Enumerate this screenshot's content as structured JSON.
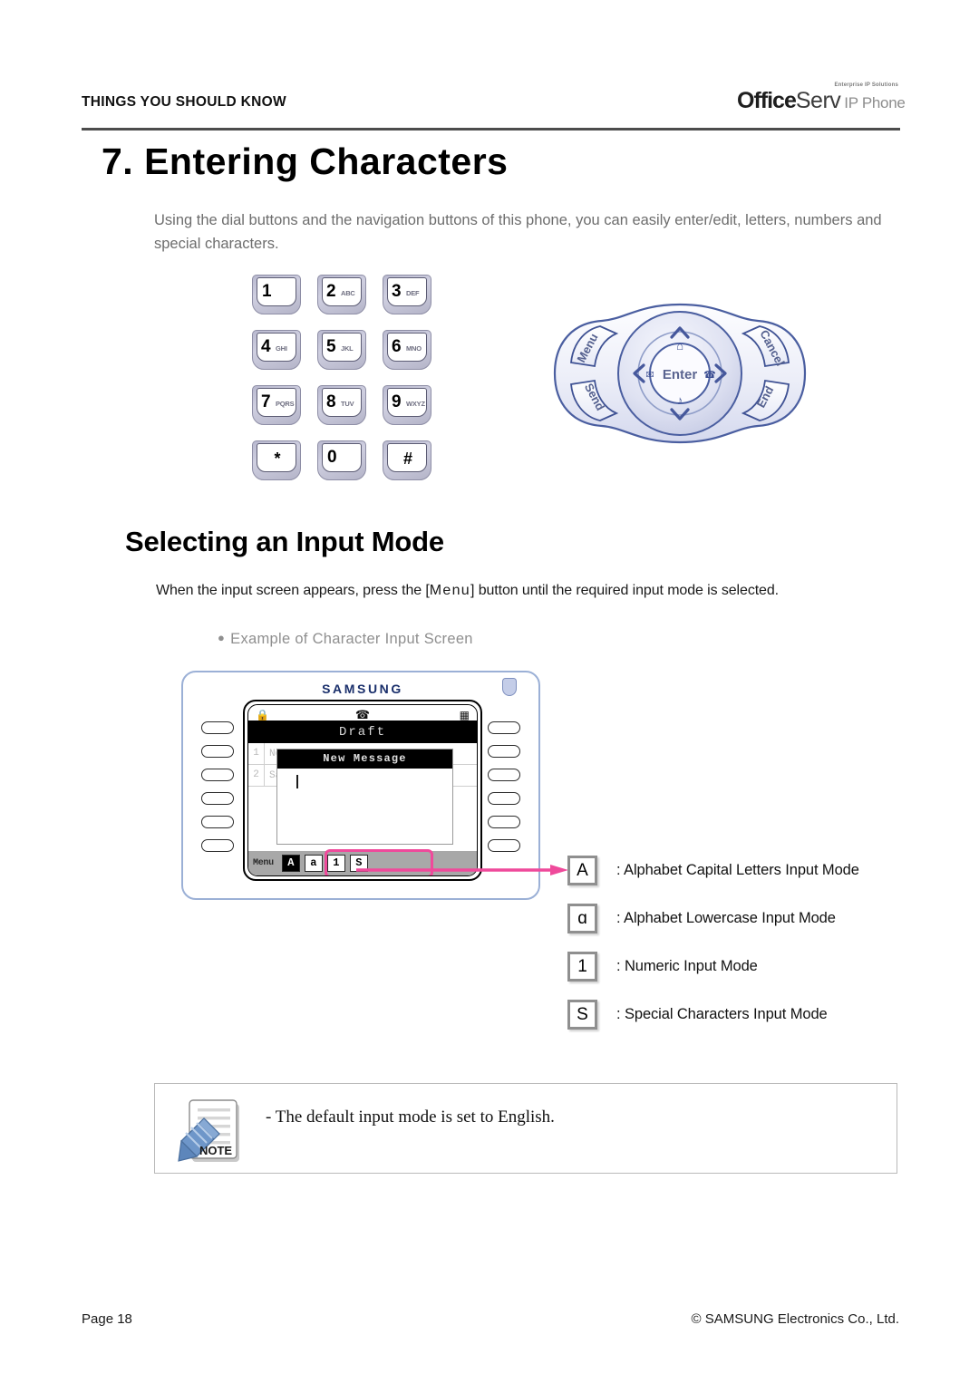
{
  "header": {
    "title": "THINGS YOU SHOULD KNOW",
    "brand_sup": "Enterprise IP Solutions",
    "brand_office": "Office",
    "brand_serv": "Serv",
    "brand_ipphone": "IP Phone"
  },
  "chapter": {
    "title": "7. Entering Characters",
    "intro": "Using the dial buttons and the navigation buttons of this phone, you can easily enter/edit,  letters, numbers and special characters."
  },
  "keypad": {
    "keys": [
      {
        "digit": "1",
        "letters": ""
      },
      {
        "digit": "2",
        "letters": "ABC"
      },
      {
        "digit": "3",
        "letters": "DEF"
      },
      {
        "digit": "4",
        "letters": "GHI"
      },
      {
        "digit": "5",
        "letters": "JKL"
      },
      {
        "digit": "6",
        "letters": "MNO"
      },
      {
        "digit": "7",
        "letters": "PQRS"
      },
      {
        "digit": "8",
        "letters": "TUV"
      },
      {
        "digit": "9",
        "letters": "WXYZ"
      },
      {
        "digit": "*",
        "letters": ""
      },
      {
        "digit": "0",
        "letters": ""
      },
      {
        "digit": "#",
        "letters": ""
      }
    ]
  },
  "navpad": {
    "center": "Enter",
    "left_top": "Menu",
    "left_bottom": "Send",
    "right_top": "Cancel",
    "right_bottom": "End"
  },
  "section": {
    "heading": "Selecting an Input Mode",
    "instruction_pre": "When the input screen appears, press the [",
    "instruction_key": "Menu",
    "instruction_post": "]  button until the required input mode is selected.",
    "bullet": "Example of Character Input Screen"
  },
  "phone": {
    "brand": "SAMSUNG",
    "lcd": {
      "title": "Draft",
      "menu_items": [
        {
          "num": "1",
          "label": "New Message"
        },
        {
          "num": "2",
          "label": "Saved Message"
        }
      ],
      "dialog_title": "New Message",
      "softkey_label": "Menu",
      "mode_chips": [
        {
          "label": "A",
          "selected": true
        },
        {
          "label": "a",
          "selected": false
        },
        {
          "label": "1",
          "selected": false
        },
        {
          "label": "S",
          "selected": false
        }
      ]
    }
  },
  "legend": {
    "rows": [
      {
        "symbol": "A",
        "text": ": Alphabet Capital Letters Input Mode"
      },
      {
        "symbol": "ɑ",
        "text": ": Alphabet Lowercase Input Mode"
      },
      {
        "symbol": "1",
        "text": ": Numeric Input Mode"
      },
      {
        "symbol": "S",
        "text": ": Special Characters Input Mode"
      }
    ]
  },
  "note": {
    "icon_label": "NOTE",
    "text": "- The default input mode is set to English."
  },
  "footer": {
    "page": "Page 18",
    "copyright": "© SAMSUNG Electronics Co., Ltd."
  },
  "colors": {
    "accent_pink": "#ef4a9b",
    "phone_outline": "#9bb0d6",
    "rule": "#4c4c4c"
  }
}
